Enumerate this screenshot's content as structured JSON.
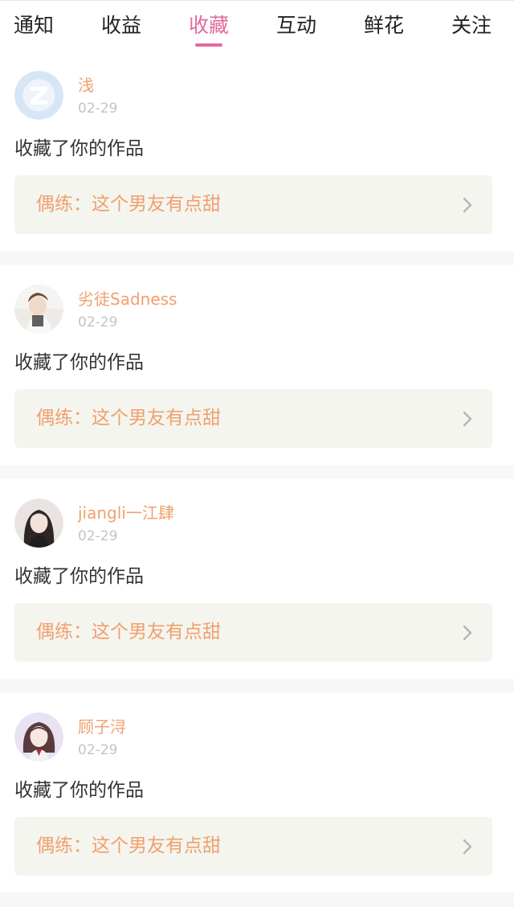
{
  "tabs": [
    {
      "label": "通知",
      "active": false
    },
    {
      "label": "收益",
      "active": false
    },
    {
      "label": "收藏",
      "active": true
    },
    {
      "label": "互动",
      "active": false
    },
    {
      "label": "鲜花",
      "active": false
    },
    {
      "label": "关注",
      "active": false
    }
  ],
  "colors": {
    "accent": "#e36a9e",
    "username": "#f0a06e",
    "work_title": "#f0a06e",
    "date": "#c4c4c4",
    "work_box_bg": "#f5f5ef"
  },
  "items": [
    {
      "username": "浅",
      "date": "02-29",
      "action": "收藏了你的作品",
      "work": "偶练：这个男友有点甜",
      "avatar": "default-qq-avatar"
    },
    {
      "username": "劣徒Sadness",
      "date": "02-29",
      "action": "收藏了你的作品",
      "work": "偶练：这个男友有点甜",
      "avatar": "photo-avatar"
    },
    {
      "username": "jiangli一江肆",
      "date": "02-29",
      "action": "收藏了你的作品",
      "work": "偶练：这个男友有点甜",
      "avatar": "photo-avatar"
    },
    {
      "username": "顾子浔",
      "date": "02-29",
      "action": "收藏了你的作品",
      "work": "偶练：这个男友有点甜",
      "avatar": "photo-avatar"
    }
  ]
}
